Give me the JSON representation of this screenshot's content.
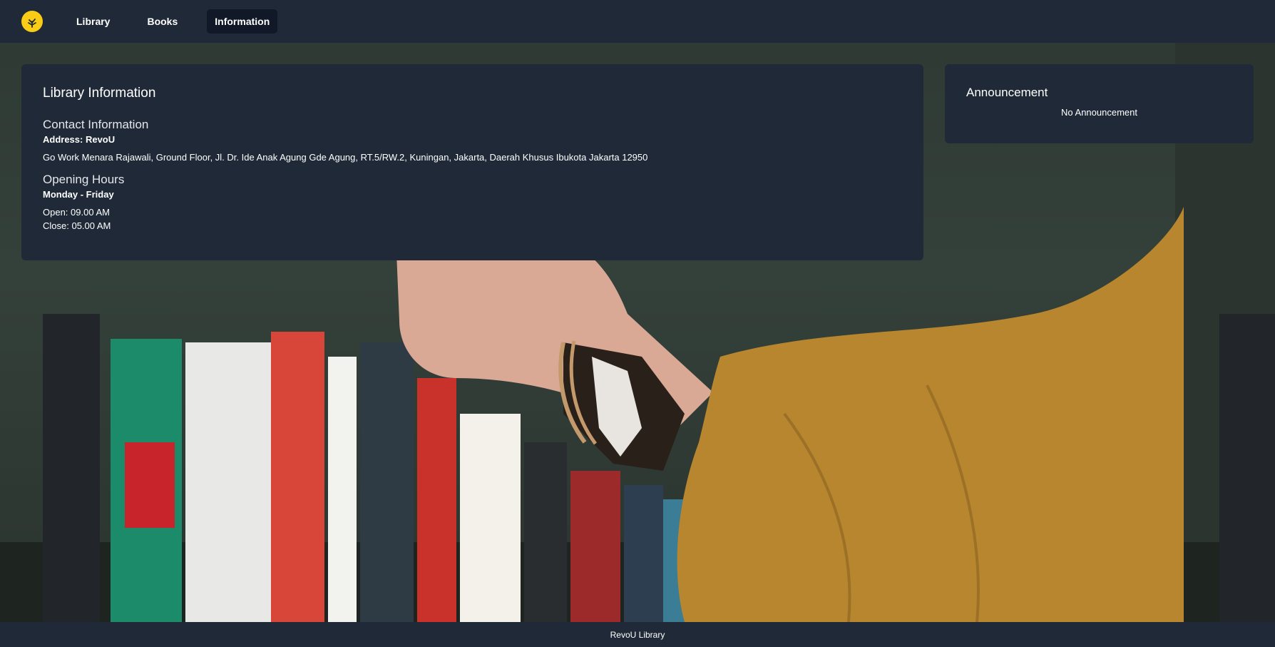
{
  "nav": {
    "logo_icon": "tree-logo-icon",
    "items": [
      {
        "label": "Library",
        "active": false
      },
      {
        "label": "Books",
        "active": false
      },
      {
        "label": "Information",
        "active": true
      }
    ]
  },
  "info": {
    "title": "Library Information",
    "contact_heading": "Contact Information",
    "address_label": "Address: RevoU",
    "address_text": "Go Work Menara Rajawali, Ground Floor, Jl. Dr. Ide Anak Agung Gde Agung, RT.5/RW.2, Kuningan, Jakarta, Daerah Khusus Ibukota Jakarta 12950",
    "hours_heading": "Opening Hours",
    "days": "Monday - Friday",
    "open": "Open: 09.00 AM",
    "close": "Close: 05.00 AM"
  },
  "announcement": {
    "title": "Announcement",
    "empty_text": "No Announcement"
  },
  "footer": {
    "text": "RevoU Library"
  },
  "colors": {
    "panel": "#1f2937",
    "active_nav": "#111827",
    "logo": "#facc15",
    "sweater": "#b8862e"
  }
}
